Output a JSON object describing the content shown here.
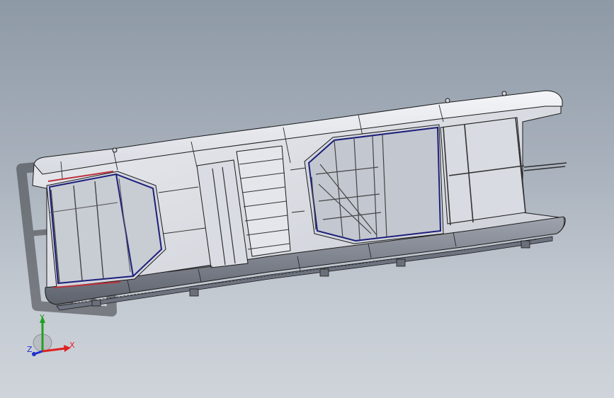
{
  "viewport": {
    "background_top": "#8e99a6",
    "background_bottom": "#cfd4da"
  },
  "model": {
    "body_color": "#e3e5ea",
    "edge_color": "#1a1a1a",
    "window_frame_color": "#1c1f7a",
    "accent_color": "#c0303a"
  },
  "triad": {
    "x_label": "X",
    "y_label": "Y",
    "z_label": "Z",
    "x_color": "#e02020",
    "y_color": "#22a022",
    "z_color": "#2030d0"
  }
}
